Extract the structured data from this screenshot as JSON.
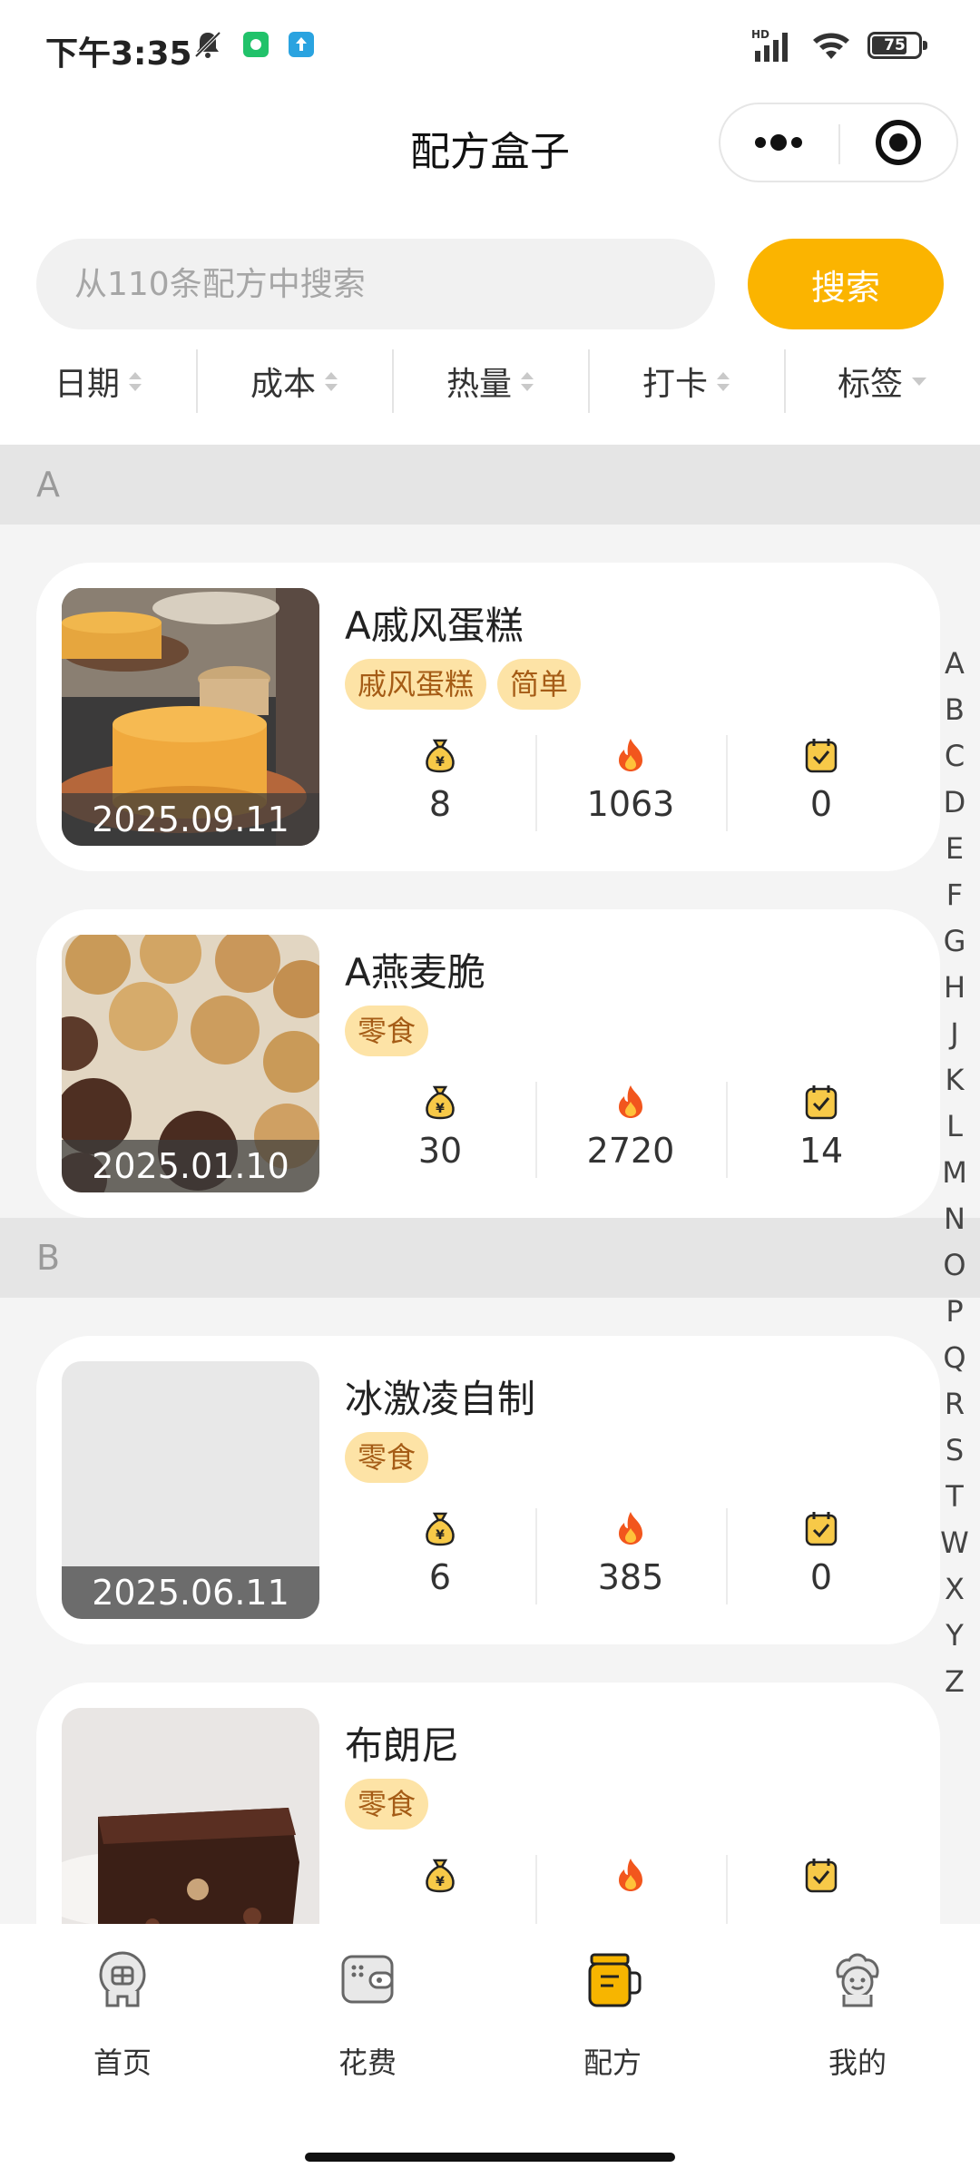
{
  "status_bar": {
    "time": "下午3:35",
    "battery": "75",
    "network": "HD"
  },
  "header": {
    "title": "配方盒子"
  },
  "search": {
    "placeholder": "从110条配方中搜索",
    "value": "",
    "button_label": "搜索"
  },
  "sort_bar": {
    "items": [
      {
        "label": "日期"
      },
      {
        "label": "成本"
      },
      {
        "label": "热量"
      },
      {
        "label": "打卡"
      },
      {
        "label": "标签"
      }
    ]
  },
  "sections": [
    {
      "letter": "A",
      "recipes": [
        {
          "title": "A戚风蛋糕",
          "date": "2025.09.11",
          "tags": [
            "戚风蛋糕",
            "简单"
          ],
          "cost": "8",
          "calories": "1063",
          "checkins": "0",
          "image": "chiffon-cake-photo"
        },
        {
          "title": "A燕麦脆",
          "date": "2025.01.10",
          "tags": [
            "零食"
          ],
          "cost": "30",
          "calories": "2720",
          "checkins": "14",
          "image": "oat-crisps-photo"
        }
      ]
    },
    {
      "letter": "B",
      "recipes": [
        {
          "title": "冰激凌自制",
          "date": "2025.06.11",
          "tags": [
            "零食"
          ],
          "cost": "6",
          "calories": "385",
          "checkins": "0",
          "image": "none"
        },
        {
          "title": "布朗尼",
          "date": "",
          "tags": [
            "零食"
          ],
          "cost": "",
          "calories": "",
          "checkins": "",
          "image": "brownie-photo"
        }
      ]
    }
  ],
  "alpha_index": [
    "A",
    "B",
    "C",
    "D",
    "E",
    "F",
    "G",
    "H",
    "J",
    "K",
    "L",
    "M",
    "N",
    "O",
    "P",
    "Q",
    "R",
    "S",
    "T",
    "W",
    "X",
    "Y",
    "Z"
  ],
  "tabbar": {
    "items": [
      {
        "label": "首页",
        "icon": "home-icon",
        "active": false
      },
      {
        "label": "花费",
        "icon": "wallet-icon",
        "active": false
      },
      {
        "label": "配方",
        "icon": "recipe-jar-icon",
        "active": true
      },
      {
        "label": "我的",
        "icon": "profile-icon",
        "active": false
      }
    ]
  },
  "colors": {
    "accent": "#fbb400",
    "tag_bg": "#fde3a6",
    "tag_text": "#a55c16",
    "section_bg": "#e5e5e5"
  }
}
